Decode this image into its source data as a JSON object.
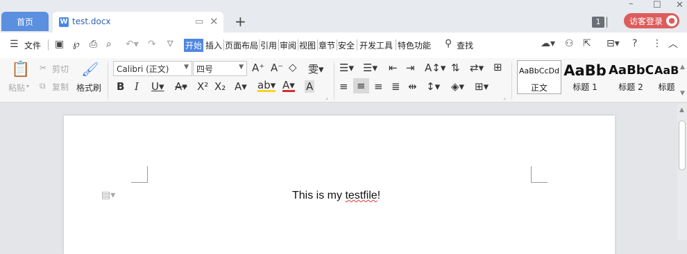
{
  "tabs": {
    "home": "首页",
    "doc": "test.docx"
  },
  "titlebar": {
    "page_count": "1",
    "login": "访客登录"
  },
  "menu": {
    "file": "文件",
    "items": [
      "开始",
      "插入",
      "页面布局",
      "引用",
      "审阅",
      "视图",
      "章节",
      "安全",
      "开发工具",
      "特色功能"
    ],
    "search": "查找"
  },
  "ribbon": {
    "paste": "粘贴",
    "cut": "剪切",
    "copy": "复制",
    "format_painter": "格式刷",
    "font_name": "Calibri (正文)",
    "font_size": "四号"
  },
  "styles": [
    {
      "preview": "AaBbCcDd",
      "name": "正文"
    },
    {
      "preview": "AaBb",
      "name": "标题 1"
    },
    {
      "preview": "AaBbC",
      "name": "标题 2"
    },
    {
      "preview": "AaB",
      "name": "标题"
    }
  ],
  "document": {
    "text_prefix": "This is my ",
    "misspelled": "testfile",
    "text_suffix": "!"
  },
  "colors": {
    "accent": "#4f86e3",
    "login": "#dd5c5c"
  }
}
